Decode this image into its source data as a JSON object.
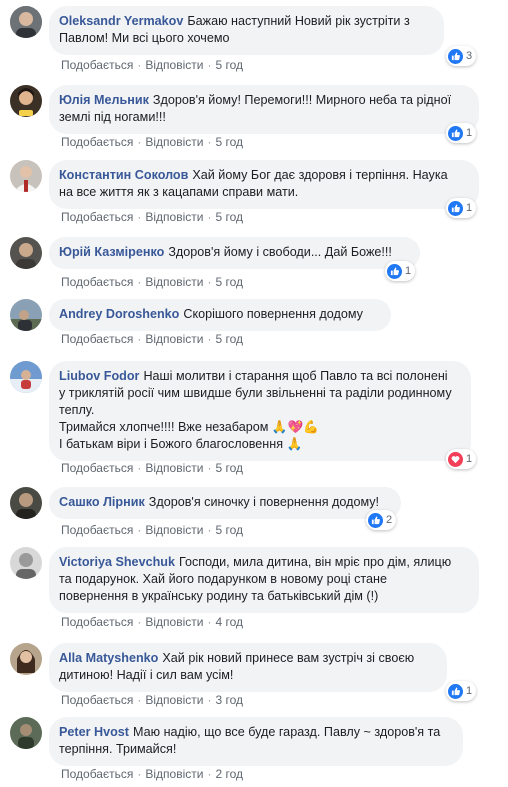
{
  "colors": {
    "author": "#385898",
    "bubble": "#f2f3f5",
    "like": "#2078f4",
    "love": "#f33e58"
  },
  "comments": [
    {
      "author": "Oleksandr Yermakov",
      "text": "Бажаю наступний Новий рік зустріти з\nПавлом! Ми всі цього хочемо",
      "like": "Подобається",
      "reply": "Відповісти",
      "time": "5 год",
      "reaction_icon": "like-icon",
      "reaction_count": "3"
    },
    {
      "author": "Юлія Мельник",
      "text": "Здоров'я йому! Перемоги!!! Мирного неба та рідної\nземлі під ногами!!!",
      "like": "Подобається",
      "reply": "Відповісти",
      "time": "5 год",
      "reaction_icon": "like-icon",
      "reaction_count": "1"
    },
    {
      "author": "Константин Соколов",
      "text": "Хай йому Бог дає здоровя і терпіння. Наука\nна все життя як з кацапами справи мати.",
      "like": "Подобається",
      "reply": "Відповісти",
      "time": "5 год",
      "reaction_icon": "like-icon",
      "reaction_count": "1"
    },
    {
      "author": "Юрій Казміренко",
      "text": "Здоров'я йому і свободи... Дай Боже!!!",
      "like": "Подобається",
      "reply": "Відповісти",
      "time": "5 год",
      "reaction_icon": "like-icon",
      "reaction_count": "1"
    },
    {
      "author": "Andrey Doroshenko",
      "text": "Скорішого повернення додому",
      "like": "Подобається",
      "reply": "Відповісти",
      "time": "5 год",
      "reaction_icon": "",
      "reaction_count": ""
    },
    {
      "author": "Liubov Fodor",
      "text": "Наші молитви і старання щоб Павло та всі полонені\nу триклятій росії чим швидше були звільненні та раділи родинному\nтеплу.\nТримайся хлопче!!!! Вже незабаром 🙏💖💪\nІ батькам віри і Божого благословення 🙏",
      "like": "Подобається",
      "reply": "Відповісти",
      "time": "5 год",
      "reaction_icon": "love-icon",
      "reaction_count": "1"
    },
    {
      "author": "Сашко Лірник",
      "text": "Здоров'я синочку і повернення додому!",
      "like": "Подобається",
      "reply": "Відповісти",
      "time": "5 год",
      "reaction_icon": "like-icon",
      "reaction_count": "2"
    },
    {
      "author": "Victoriya Shevchuk",
      "text": "Господи, мила дитина, він мріє про дім, ялицю\nта подарунок. Хай його подарунком в новому році стане\nповернення в українську родину та батьківський дім (!)",
      "like": "Подобається",
      "reply": "Відповісти",
      "time": "4 год",
      "reaction_icon": "",
      "reaction_count": ""
    },
    {
      "author": "Alla Matyshenko",
      "text": "Хай рік новий принесе вам зустріч зі своєю\nдитиною! Надії і сил вам усім!",
      "like": "Подобається",
      "reply": "Відповісти",
      "time": "3 год",
      "reaction_icon": "like-icon",
      "reaction_count": "1"
    },
    {
      "author": "Peter Hvost",
      "text": "Маю надію, що все буде гаразд. Павлу ~ здоров'я та\nтерпіння. Тримайся!",
      "like": "Подобається",
      "reply": "Відповісти",
      "time": "2 год",
      "reaction_icon": "",
      "reaction_count": ""
    }
  ]
}
